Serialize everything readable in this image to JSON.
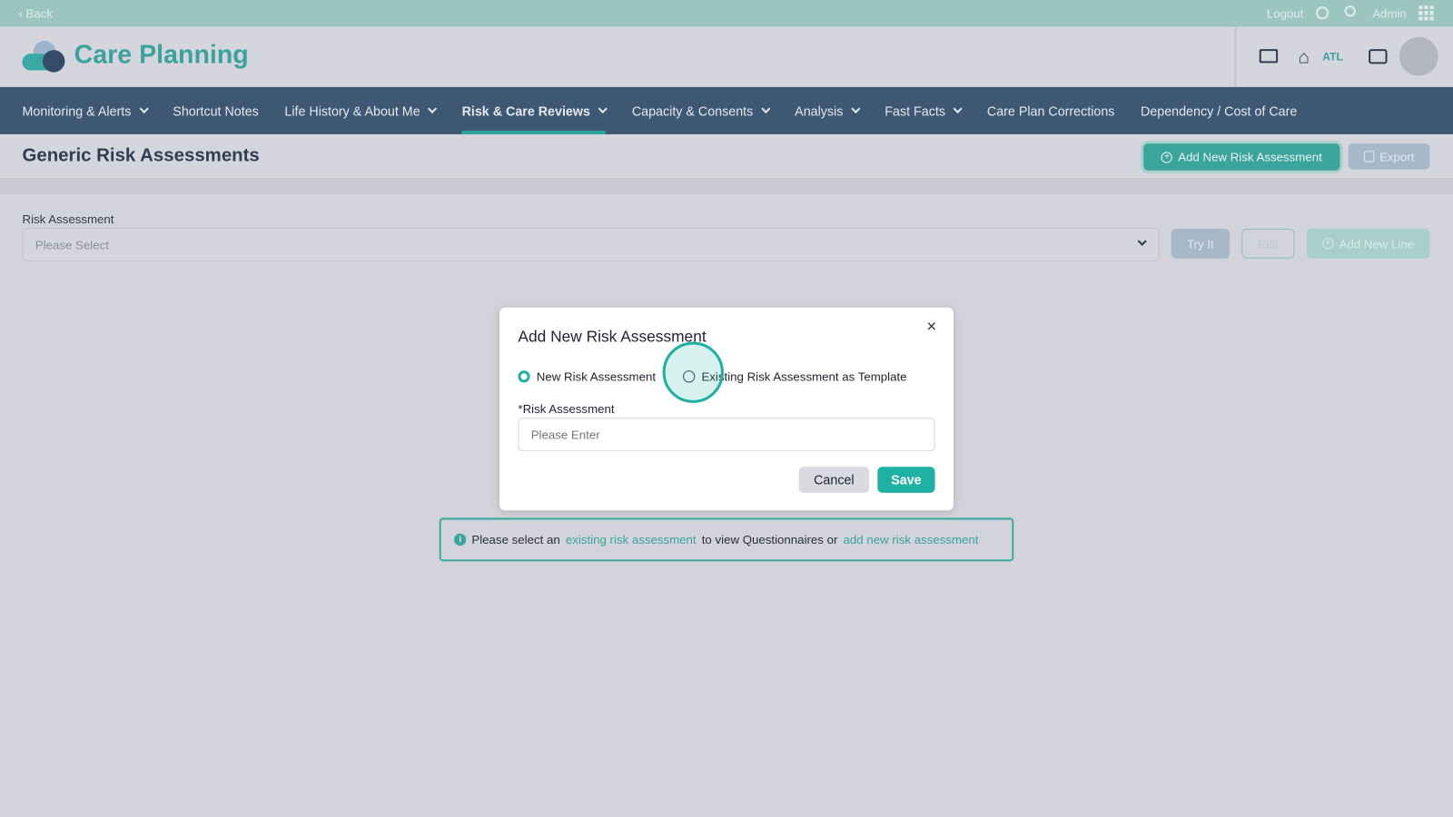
{
  "topbar": {
    "back": "‹ Back",
    "logout": "Logout",
    "user": "Admin"
  },
  "header": {
    "app_title": "Care Planning",
    "home_label": "ATL"
  },
  "nav": {
    "items": [
      {
        "label": "Monitoring & Alerts",
        "dropdown": true
      },
      {
        "label": "Shortcut Notes",
        "dropdown": false
      },
      {
        "label": "Life History & About Me",
        "dropdown": true
      },
      {
        "label": "Risk & Care Reviews",
        "dropdown": true,
        "active": true
      },
      {
        "label": "Capacity & Consents",
        "dropdown": true
      },
      {
        "label": "Analysis",
        "dropdown": true
      },
      {
        "label": "Fast Facts",
        "dropdown": true
      },
      {
        "label": "Care Plan Corrections",
        "dropdown": false
      },
      {
        "label": "Dependency / Cost of Care",
        "dropdown": false
      }
    ]
  },
  "page": {
    "title": "Generic Risk Assessments",
    "add_button": "Add New Risk Assessment",
    "export_button": "Export",
    "field_label": "Risk Assessment",
    "select_placeholder": "Please Select",
    "try_button": "Try It",
    "edit_button": "Edit",
    "add_line_button": "Add New Line"
  },
  "modal": {
    "title": "Add New Risk Assessment",
    "option_new": "New Risk Assessment",
    "option_existing": "Existing Risk Assessment as Template",
    "field_label": "*Risk Assessment",
    "input_placeholder": "Please Enter",
    "cancel": "Cancel",
    "save": "Save"
  },
  "info": {
    "text1": "Please select an",
    "link1": "existing risk assessment",
    "text2": "to view Questionnaires or",
    "link2": "add new risk assessment"
  },
  "colors": {
    "accent": "#2aa39b",
    "nav": "#3e5873",
    "topbar": "#9cc5c0"
  }
}
